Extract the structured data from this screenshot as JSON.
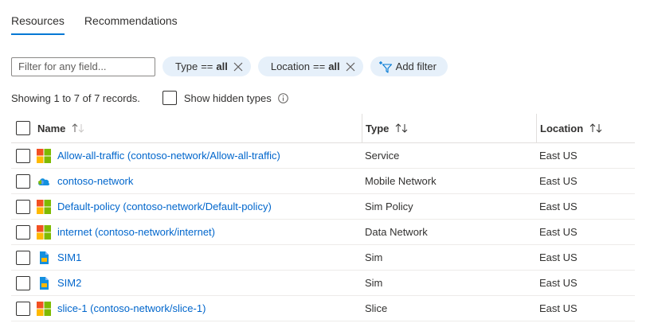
{
  "tabs": [
    {
      "label": "Resources",
      "active": true
    },
    {
      "label": "Recommendations",
      "active": false
    }
  ],
  "filter": {
    "placeholder": "Filter for any field..."
  },
  "pills": [
    {
      "field": "Type",
      "op": "==",
      "value": "all"
    },
    {
      "field": "Location",
      "op": "==",
      "value": "all"
    }
  ],
  "add_filter_label": "Add filter",
  "status_text": "Showing 1 to 7 of 7 records.",
  "show_hidden_label": "Show hidden types",
  "columns": {
    "name": "Name",
    "type": "Type",
    "location": "Location"
  },
  "rows": [
    {
      "name": "Allow-all-traffic (contoso-network/Allow-all-traffic)",
      "type": "Service",
      "location": "East US",
      "icon": "resource-grid-icon"
    },
    {
      "name": "contoso-network",
      "type": "Mobile Network",
      "location": "East US",
      "icon": "mobile-network-icon"
    },
    {
      "name": "Default-policy (contoso-network/Default-policy)",
      "type": "Sim Policy",
      "location": "East US",
      "icon": "resource-grid-icon"
    },
    {
      "name": "internet (contoso-network/internet)",
      "type": "Data Network",
      "location": "East US",
      "icon": "resource-grid-icon"
    },
    {
      "name": "SIM1",
      "type": "Sim",
      "location": "East US",
      "icon": "sim-card-icon"
    },
    {
      "name": "SIM2",
      "type": "Sim",
      "location": "East US",
      "icon": "sim-card-icon"
    },
    {
      "name": "slice-1 (contoso-network/slice-1)",
      "type": "Slice",
      "location": "East US",
      "icon": "resource-grid-icon"
    }
  ],
  "colors": {
    "accent": "#0078d4",
    "link": "#0066cc",
    "pill_bg": "#e6f0fa"
  }
}
